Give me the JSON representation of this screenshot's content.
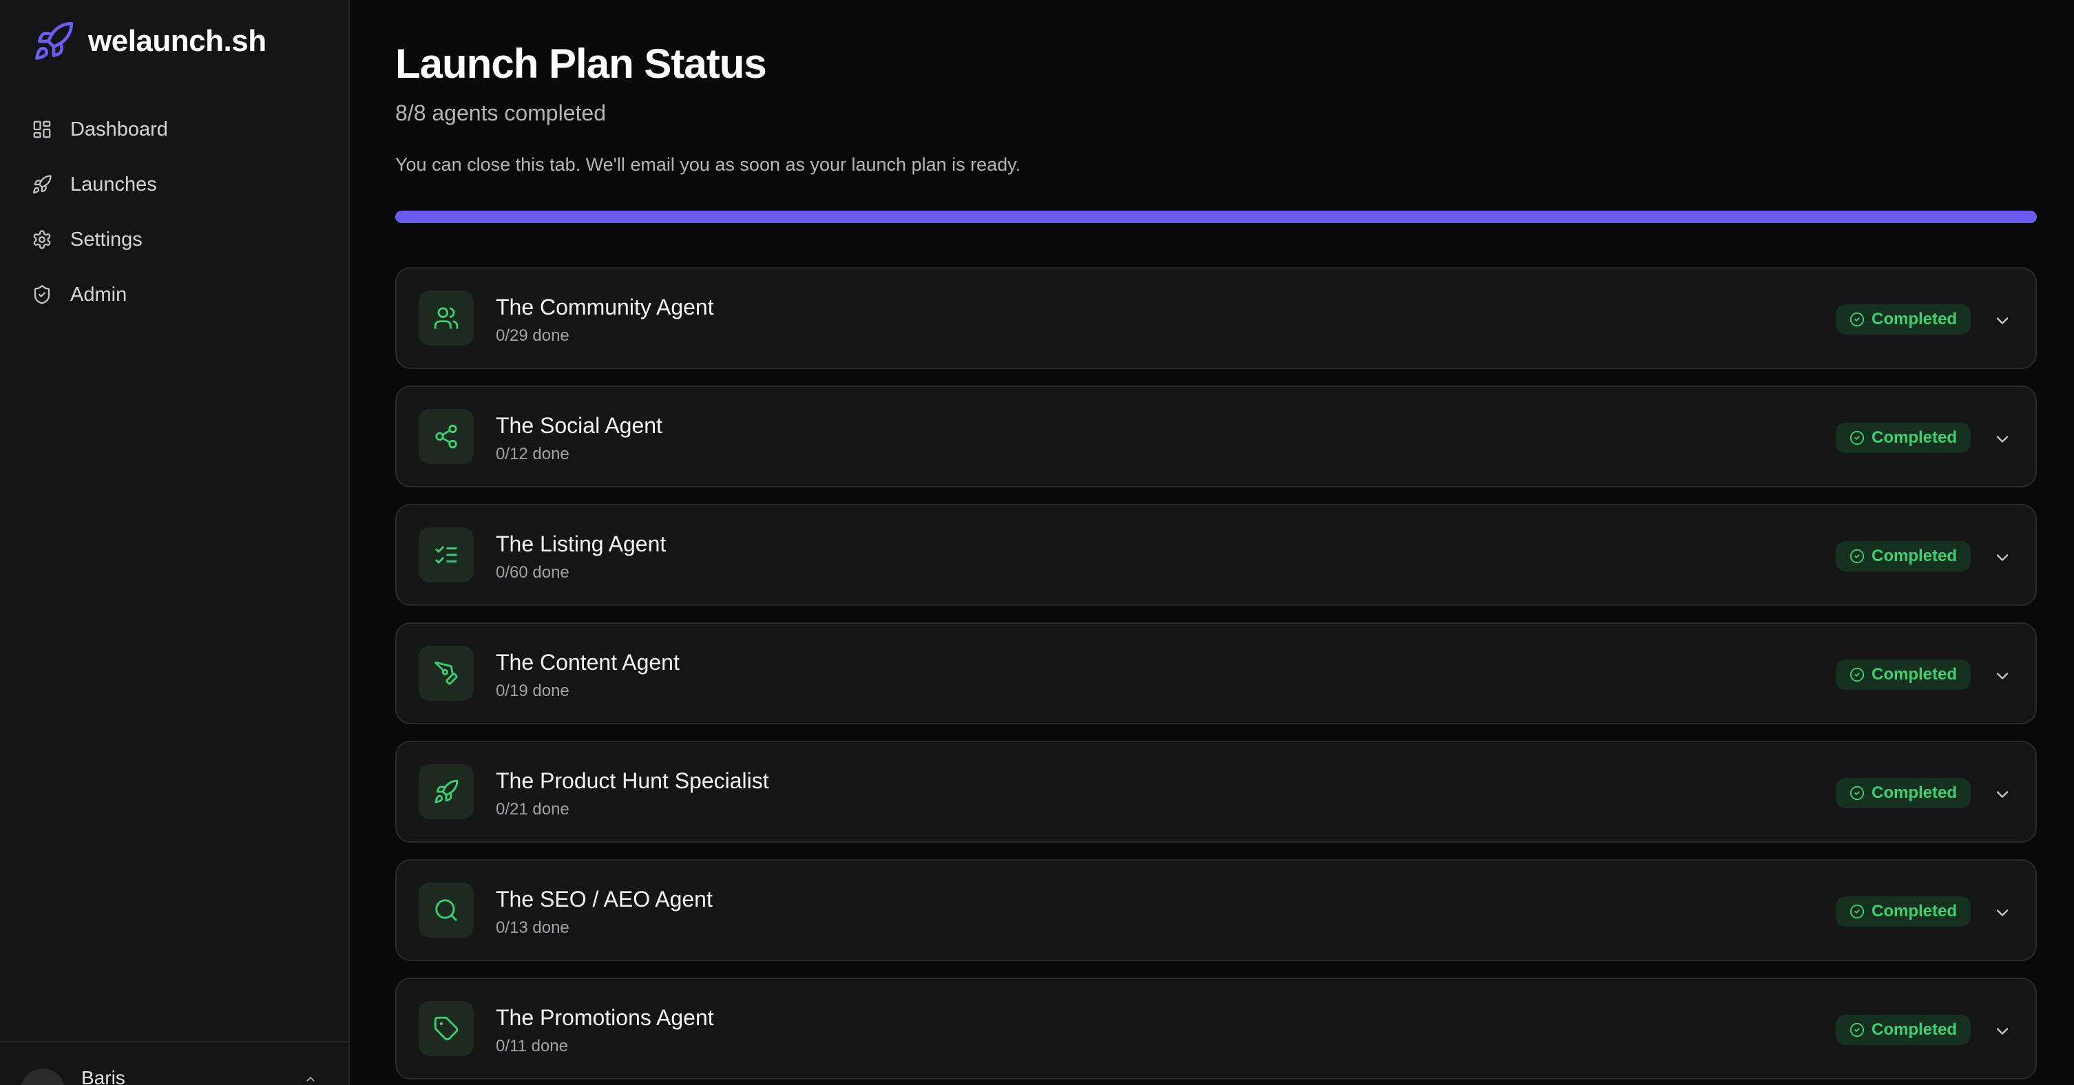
{
  "app": {
    "brand_name": "welaunch.sh",
    "logo_icon": "rocket-icon",
    "accent_color": "#6a5ef0"
  },
  "sidebar": {
    "items": [
      {
        "label": "Dashboard",
        "icon": "dashboard-icon"
      },
      {
        "label": "Launches",
        "icon": "rocket-icon"
      },
      {
        "label": "Settings",
        "icon": "gear-icon"
      },
      {
        "label": "Admin",
        "icon": "shield-icon"
      }
    ],
    "user": {
      "name": "Baris"
    }
  },
  "header": {
    "title": "Launch Plan Status",
    "subtitle": "8/8 agents completed",
    "note": "You can close this tab. We'll email you as soon as your launch plan is ready."
  },
  "progress": {
    "value_percent": 100,
    "color": "#6a5ef0"
  },
  "status_color": "#3fcf73",
  "agents": [
    {
      "title": "The Community Agent",
      "progress": "0/29 done",
      "status": "Completed",
      "icon": "users-icon"
    },
    {
      "title": "The Social Agent",
      "progress": "0/12 done",
      "status": "Completed",
      "icon": "share-icon"
    },
    {
      "title": "The Listing Agent",
      "progress": "0/60 done",
      "status": "Completed",
      "icon": "list-check-icon"
    },
    {
      "title": "The Content Agent",
      "progress": "0/19 done",
      "status": "Completed",
      "icon": "pen-tool-icon"
    },
    {
      "title": "The Product Hunt Specialist",
      "progress": "0/21 done",
      "status": "Completed",
      "icon": "rocket-icon"
    },
    {
      "title": "The SEO / AEO Agent",
      "progress": "0/13 done",
      "status": "Completed",
      "icon": "search-icon"
    },
    {
      "title": "The Promotions Agent",
      "progress": "0/11 done",
      "status": "Completed",
      "icon": "tag-icon"
    }
  ]
}
